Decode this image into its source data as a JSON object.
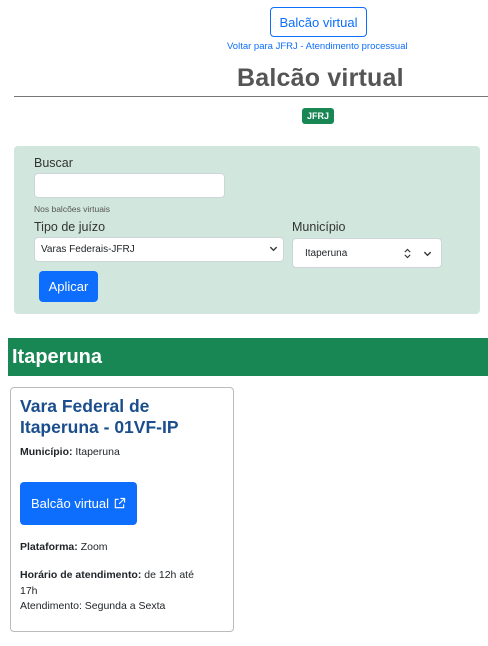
{
  "header": {
    "top_button": "Balcão virtual",
    "back_link": "Voltar para JFRJ - Atendimento processual",
    "title": "Balcão virtual",
    "badge": "JFRJ"
  },
  "filters": {
    "search_label": "Buscar",
    "search_value": "",
    "search_help": "Nos balcões virtuais",
    "tipo_label": "Tipo de juízo",
    "tipo_value": "Varas Federais-JFRJ",
    "municipio_label": "Município",
    "municipio_value": "Itaperuna",
    "apply_button": "Aplicar"
  },
  "results": {
    "city": "Itaperuna",
    "card": {
      "title": "Vara Federal de Itaperuna - 01VF-IP",
      "municipio_label": "Município:",
      "municipio_value": "Itaperuna",
      "button": "Balcão virtual",
      "plataforma_label": "Plataforma:",
      "plataforma_value": "Zoom",
      "horario_label": "Horário de atendimento:",
      "horario_value_1": "de 12h até",
      "horario_value_2": "17h",
      "atendimento": "Atendimento: Segunda a Sexta"
    }
  }
}
